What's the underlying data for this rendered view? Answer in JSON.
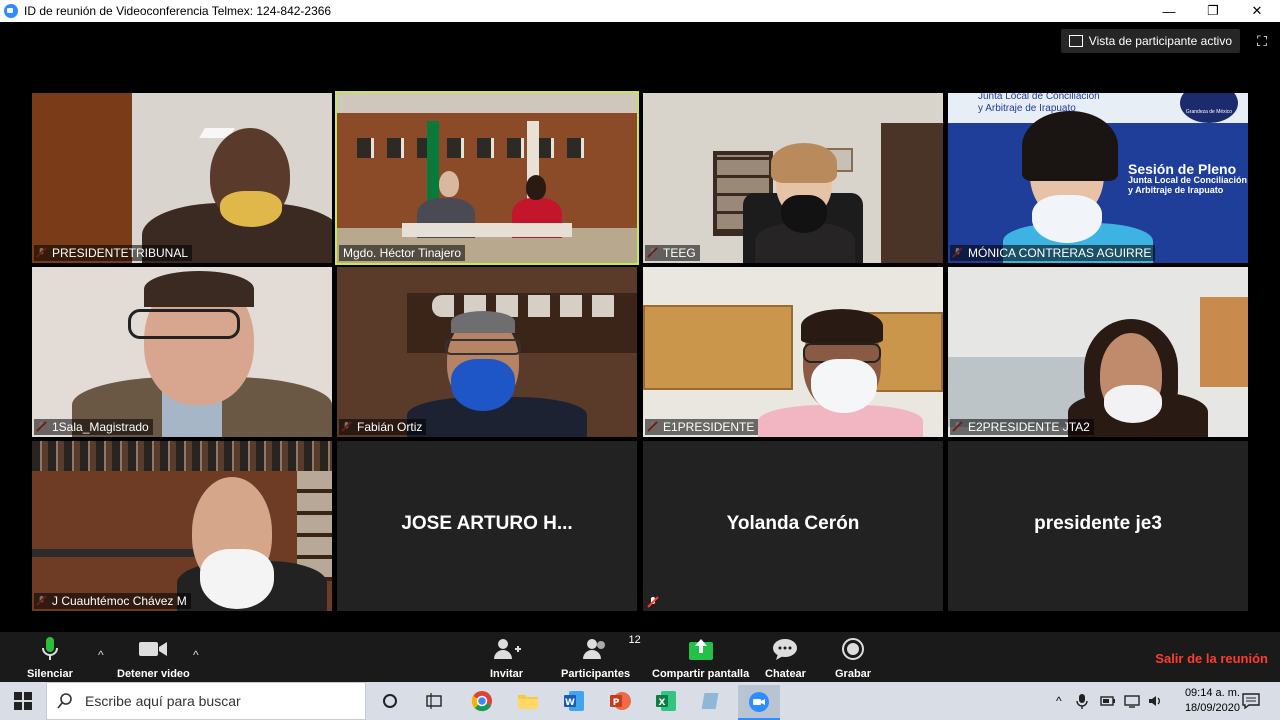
{
  "window": {
    "title": "ID de reunión de Videoconferencia Telmex: 124-842-2366",
    "min": "—",
    "max": "❐",
    "close": "✕"
  },
  "view_button": {
    "label": "Vista de participante activo"
  },
  "participants": [
    {
      "name": "PRESIDENTETRIBUNAL",
      "muted": true
    },
    {
      "name": "Mgdo. Héctor Tinajero",
      "muted": false,
      "active": true
    },
    {
      "name": "TEEG",
      "muted": true
    },
    {
      "name": "MÓNICA CONTRERAS AGUIRRE",
      "muted": true
    },
    {
      "name": "1Sala_Magistrado",
      "muted": true
    },
    {
      "name": "Fabián Ortiz",
      "muted": true
    },
    {
      "name": "E1PRESIDENTE",
      "muted": true
    },
    {
      "name": "E2PRESIDENTE JTA2",
      "muted": true
    },
    {
      "name": "J Cuauhtémoc Chávez M",
      "muted": true
    },
    {
      "name": "JOSE ARTURO H...",
      "video": false
    },
    {
      "name": "Yolanda Cerón",
      "video": false,
      "muted": true
    },
    {
      "name": "presidente je3",
      "video": false
    }
  ],
  "scene_text": {
    "sign_line1": "Junta Local de Conciliación",
    "sign_line2": "y Arbitraje de Irapuato",
    "banner_line1": "Sesión de Pleno",
    "banner_line2": "Junta Local de Conciliación",
    "banner_line3": "y Arbitraje de Irapuato",
    "logo_text": "Grandeza de México"
  },
  "toolbar": {
    "mute": "Silenciar",
    "stop_video": "Detener video",
    "invite": "Invitar",
    "participants": "Participantes",
    "participants_count": "12",
    "share": "Compartir pantalla",
    "chat": "Chatear",
    "record": "Grabar",
    "leave": "Salir de la reunión"
  },
  "taskbar": {
    "search_placeholder": "Escribe aquí para buscar",
    "time": "09:14 a. m.",
    "date": "18/09/2020"
  },
  "colors": {
    "active_speaker": "#C8E655",
    "leave": "#FF3B30",
    "share_green": "#24C14A",
    "mic_green": "#2BBF3B"
  }
}
